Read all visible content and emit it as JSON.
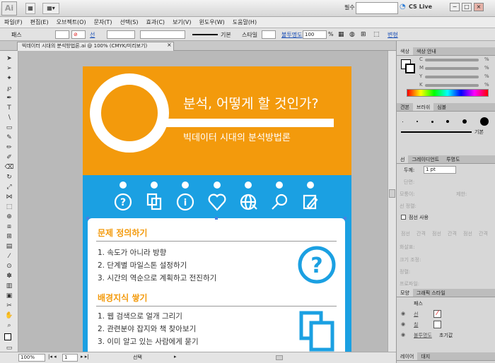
{
  "app": {
    "logo": "Ai",
    "workspace": "필수",
    "cslive": "CS Live"
  },
  "menu": [
    "파일(F)",
    "편집(E)",
    "오브젝트(O)",
    "문자(T)",
    "선택(S)",
    "효과(C)",
    "보기(V)",
    "윈도우(W)",
    "도움말(H)"
  ],
  "control": {
    "object_type": "패스",
    "stroke_label": "선",
    "stroke_style": "기본",
    "style_label": "스타일",
    "opacity_label": "불투명도",
    "opacity_value": "100",
    "opacity_unit": "%",
    "transform": "변형"
  },
  "document_tab": "빅데이터 시대의 분석방법론.ai @ 100% (CMYK/미리보기)",
  "artboard": {
    "headline": "분석, 어떻게 할 것인가?",
    "subtitle": "빅데이터 시대의 분석방법론",
    "section1_title": "문제 정의하기",
    "section1_items": [
      "1. 속도가 아니라 방향",
      "2. 단계별 마일스톤 설정하기",
      "3. 시간의 역순으로 계획하고 전진하기"
    ],
    "section2_title": "배경지식 쌓기",
    "section2_items": [
      "1. 웹 검색으로 얼개 그리기",
      "2. 관련분야 잡지와 책 찾아보기",
      "3. 이미 알고 있는 사람에게 묻기"
    ],
    "icons": [
      "question-icon",
      "copy-icon",
      "info-icon",
      "heart-icon",
      "globe-icon",
      "search-icon",
      "edit-icon"
    ],
    "colors": {
      "orange": "#f39a0c",
      "blue": "#1ba0e2",
      "heading": "#f39a0c"
    }
  },
  "status": {
    "zoom": "100%",
    "page": "1",
    "selection": "선택"
  },
  "panels": {
    "color": {
      "tabs": [
        "색상",
        "색상 안내"
      ],
      "channels": [
        "C",
        "M",
        "Y",
        "K"
      ],
      "unit": "%"
    },
    "brush": {
      "tabs": [
        "견본",
        "브러쉬",
        "심볼"
      ],
      "style_label": "기본"
    },
    "stroke": {
      "tabs": [
        "선",
        "그레이디언트",
        "투명도"
      ],
      "weight_label": "두께:",
      "weight_value": "1 pt",
      "cap_label": "단면:",
      "corner_label": "모퉁이:",
      "limit_label": "제한:",
      "align_label": "선 정렬:",
      "dashed_label": "점선 사용",
      "dash_labels": [
        "점선",
        "간격",
        "점선",
        "간격",
        "점선",
        "간격"
      ],
      "arrow_label": "화살표:",
      "scale_label": "크기 조정:",
      "align2_label": "정렬:",
      "profile_label": "프로파일:"
    },
    "appearance": {
      "tabs": [
        "모양",
        "그래픽 스타일"
      ],
      "title": "패스",
      "stroke_label": "선",
      "fill_label": "칠",
      "opacity_label": "불투명도",
      "opacity_value": "초기값"
    },
    "layers": {
      "tabs": [
        "레이어",
        "대지"
      ]
    }
  }
}
